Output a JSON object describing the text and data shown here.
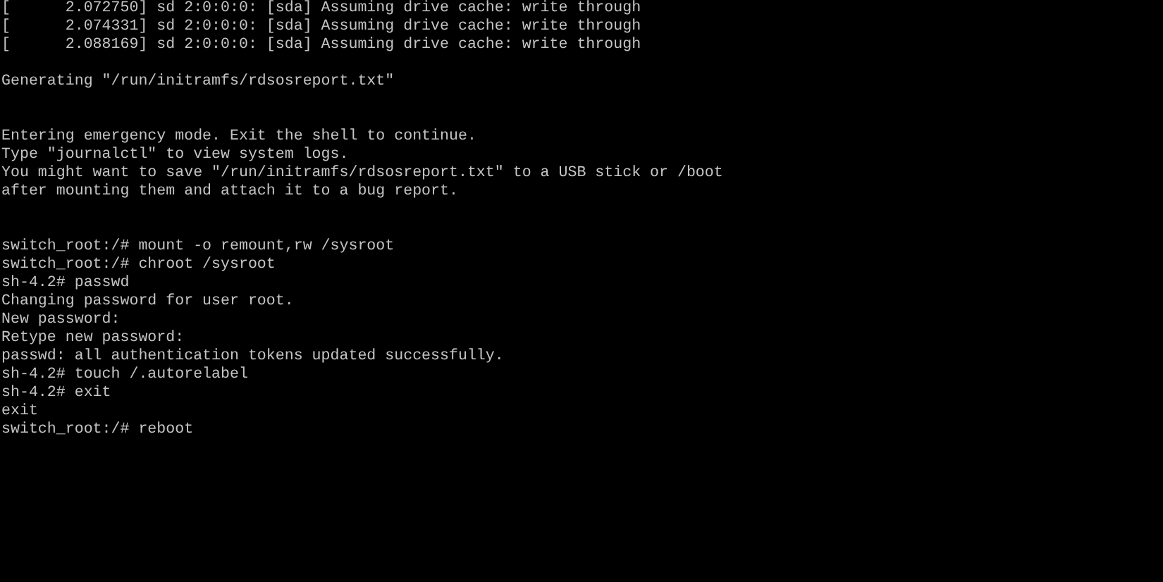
{
  "console": {
    "blocks": [
      {
        "kind": "log",
        "lines": [
          "[      2.072750] sd 2:0:0:0: [sda] Assuming drive cache: write through",
          "[      2.074331] sd 2:0:0:0: [sda] Assuming drive cache: write through",
          "[      2.088169] sd 2:0:0:0: [sda] Assuming drive cache: write through"
        ]
      },
      {
        "kind": "status",
        "lines": [
          "Generating \"/run/initramfs/rdsosreport.txt\""
        ]
      },
      {
        "kind": "notice",
        "lines": [
          "Entering emergency mode. Exit the shell to continue.",
          "Type \"journalctl\" to view system logs.",
          "You might want to save \"/run/initramfs/rdsosreport.txt\" to a USB stick or /boot",
          "after mounting them and attach it to a bug report."
        ]
      },
      {
        "kind": "session",
        "lines": [
          "switch_root:/# mount -o remount,rw /sysroot",
          "switch_root:/# chroot /sysroot",
          "sh-4.2# passwd",
          "Changing password for user root.",
          "New password:",
          "Retype new password:",
          "passwd: all authentication tokens updated successfully.",
          "sh-4.2# touch /.autorelabel",
          "sh-4.2# exit",
          "exit",
          "switch_root:/# reboot"
        ]
      }
    ]
  }
}
